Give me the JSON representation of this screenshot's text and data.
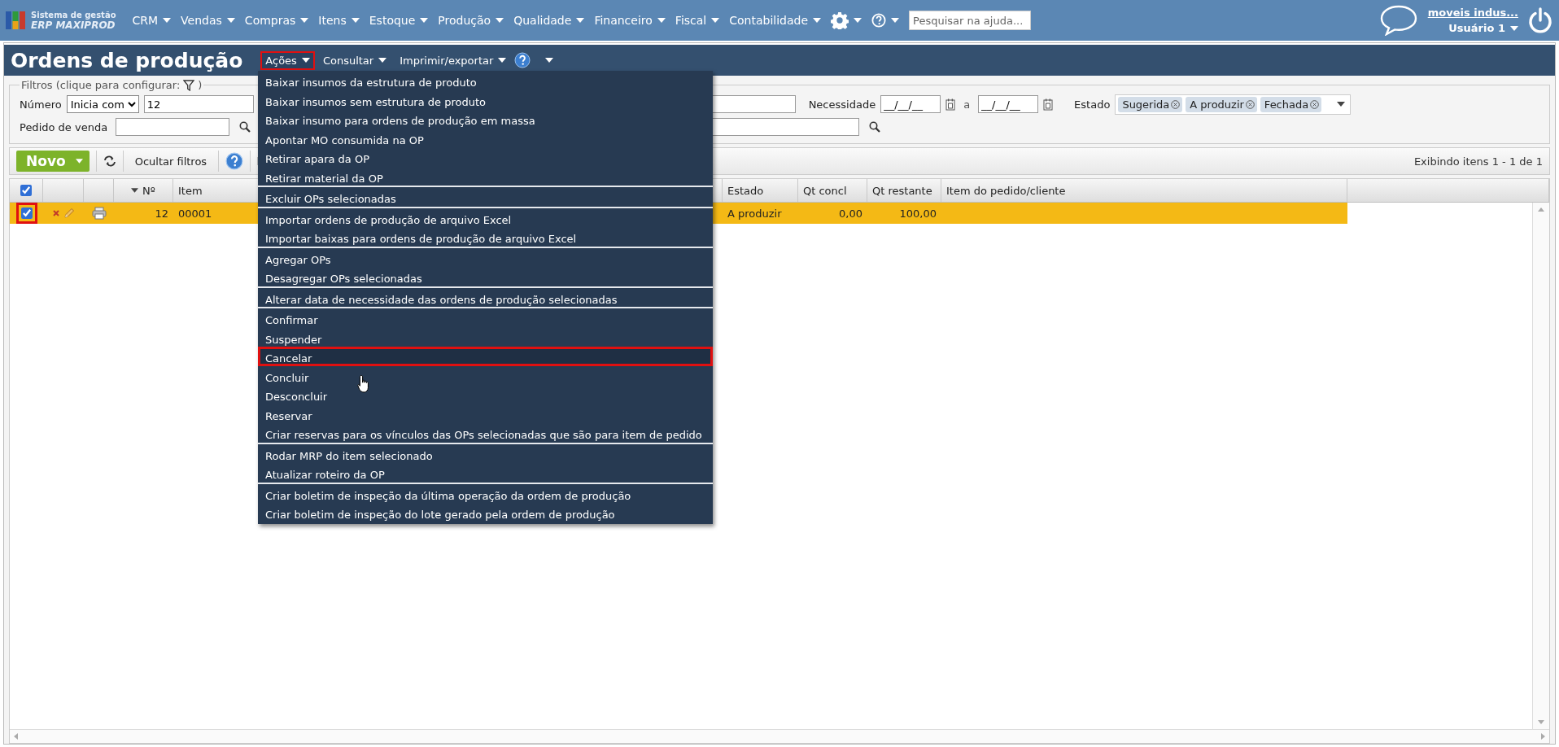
{
  "app": {
    "logo_line1": "Sistema de gestão",
    "logo_line2": "ERP MAXIPROD"
  },
  "nav": [
    {
      "label": "CRM"
    },
    {
      "label": "Vendas"
    },
    {
      "label": "Compras"
    },
    {
      "label": "Itens"
    },
    {
      "label": "Estoque"
    },
    {
      "label": "Produção"
    },
    {
      "label": "Qualidade"
    },
    {
      "label": "Financeiro"
    },
    {
      "label": "Fiscal"
    },
    {
      "label": "Contabilidade"
    }
  ],
  "help_search": {
    "placeholder": "Pesquisar na ajuda..."
  },
  "user": {
    "company": "moveis indus...",
    "name": "Usuário 1"
  },
  "page": {
    "title": "Ordens de produção"
  },
  "page_menu": [
    {
      "label": "Ações",
      "selected": true,
      "callout": true
    },
    {
      "label": "Consultar",
      "selected": false,
      "callout": false
    },
    {
      "label": "Imprimir/exportar",
      "selected": false,
      "callout": false
    }
  ],
  "filters": {
    "legend": "Filtros (clique para configurar:",
    "legend_end": ")",
    "numero": {
      "label": "Número",
      "operator": "Inicia com",
      "value": "12"
    },
    "necessidade": {
      "label": "Necessidade",
      "from": "__/__/__",
      "between": "a",
      "to": "__/__/__"
    },
    "estado": {
      "label": "Estado",
      "tags": [
        "Sugerida",
        "A produzir",
        "Fechada"
      ]
    },
    "pedido": {
      "label": "Pedido de venda"
    }
  },
  "toolbar": {
    "new_button": "Novo",
    "hide_filters": "Ocultar filtros",
    "paging": "Exibindo itens 1 - 1 de 1"
  },
  "table": {
    "select_all": true,
    "columns": {
      "number": "Nº",
      "item": "Item",
      "estado": "Estado",
      "qt_concl": "Qt concl",
      "qt_restante": "Qt restante",
      "pedido_cliente": "Item do pedido/cliente"
    },
    "rows": [
      {
        "checked": true,
        "callout": true,
        "selected": true,
        "number": "12",
        "item": "00001",
        "estado": "A produzir",
        "qt_concl": "0,00",
        "qt_restante": "100,00"
      }
    ]
  },
  "actions_menu": {
    "groups": [
      {
        "items": [
          {
            "label": "Baixar insumos da estrutura de produto",
            "selected": false,
            "callout": false
          },
          {
            "label": "Baixar insumos sem estrutura de produto",
            "selected": false,
            "callout": false
          },
          {
            "label": "Baixar insumo para ordens de produção em massa",
            "selected": false,
            "callout": false
          },
          {
            "label": "Apontar MO consumida na OP",
            "selected": false,
            "callout": false
          },
          {
            "label": "Retirar apara da OP",
            "selected": false,
            "callout": false
          },
          {
            "label": "Retirar material da OP",
            "selected": false,
            "callout": false
          }
        ]
      },
      {
        "items": [
          {
            "label": "Excluir OPs selecionadas",
            "selected": false,
            "callout": false
          }
        ]
      },
      {
        "items": [
          {
            "label": "Importar ordens de produção de arquivo Excel",
            "selected": false,
            "callout": false
          },
          {
            "label": "Importar baixas para ordens de produção de arquivo Excel",
            "selected": false,
            "callout": false
          }
        ]
      },
      {
        "items": [
          {
            "label": "Agregar OPs",
            "selected": false,
            "callout": false
          },
          {
            "label": "Desagregar OPs selecionadas",
            "selected": false,
            "callout": false
          }
        ]
      },
      {
        "items": [
          {
            "label": "Alterar data de necessidade das ordens de produção selecionadas",
            "selected": false,
            "callout": false
          }
        ]
      },
      {
        "items": [
          {
            "label": "Confirmar",
            "selected": false,
            "callout": false
          },
          {
            "label": "Suspender",
            "selected": false,
            "callout": false
          },
          {
            "label": "Cancelar",
            "selected": true,
            "callout": true
          },
          {
            "label": "Concluir",
            "selected": false,
            "callout": false
          },
          {
            "label": "Desconcluir",
            "selected": false,
            "callout": false
          },
          {
            "label": "Reservar",
            "selected": false,
            "callout": false
          },
          {
            "label": "Criar reservas para os vínculos das OPs selecionadas que são para item de pedido",
            "selected": false,
            "callout": false
          }
        ]
      },
      {
        "items": [
          {
            "label": "Rodar MRP do item selecionado",
            "selected": false,
            "callout": false
          },
          {
            "label": "Atualizar roteiro da OP",
            "selected": false,
            "callout": false
          }
        ]
      },
      {
        "items": [
          {
            "label": "Criar boletim de inspeção da última operação da ordem de produção",
            "selected": false,
            "callout": false
          },
          {
            "label": "Criar boletim de inspeção do lote gerado pela ordem de produção",
            "selected": false,
            "callout": false
          }
        ]
      }
    ]
  }
}
